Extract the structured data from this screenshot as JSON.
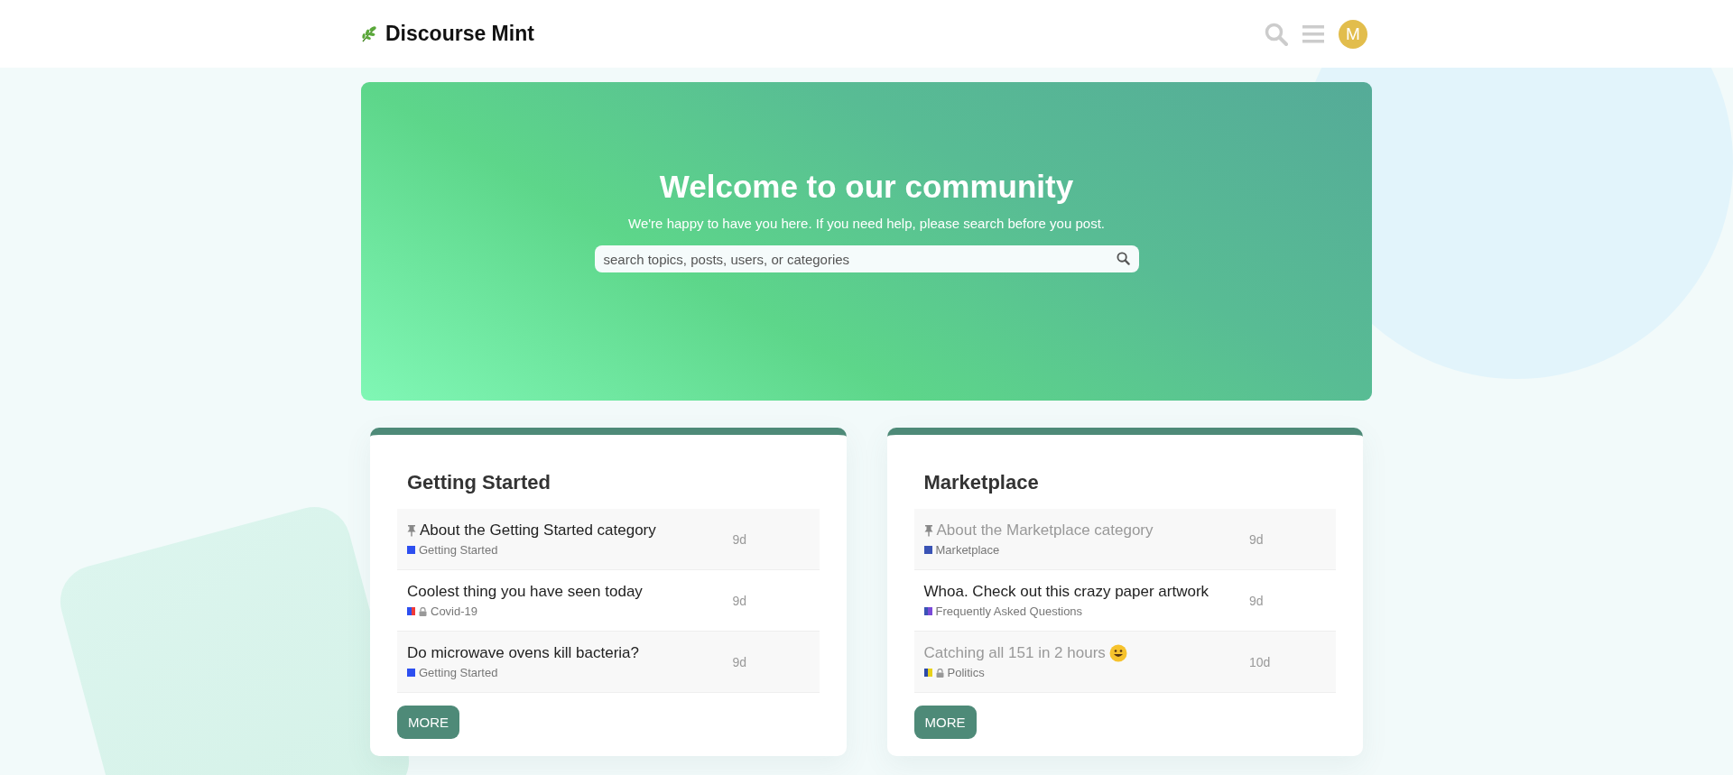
{
  "header": {
    "site_title": "Discourse Mint",
    "avatar_letter": "M"
  },
  "hero": {
    "title": "Welcome to our community",
    "subtitle": "We're happy to have you here. If you need help, please search before you post.",
    "search": {
      "placeholder": "search topics, posts, users, or categories"
    }
  },
  "categories": [
    {
      "name": "Getting Started",
      "more_button": "MORE",
      "topics": [
        {
          "title": "About the Getting Started category",
          "pinned": true,
          "read": false,
          "emoji": false,
          "category": {
            "name": "Getting Started",
            "locked": false,
            "stripes": [
              {
                "color": "#2d4ff0"
              }
            ]
          },
          "age": "9d"
        },
        {
          "title": "Coolest thing you have seen today",
          "pinned": false,
          "read": false,
          "emoji": false,
          "category": {
            "name": "Covid-19",
            "locked": true,
            "stripes": [
              {
                "color": "#2d4ff0"
              },
              {
                "color": "#f03a3a"
              }
            ]
          },
          "age": "9d"
        },
        {
          "title": "Do microwave ovens kill bacteria?",
          "pinned": false,
          "read": false,
          "emoji": false,
          "category": {
            "name": "Getting Started",
            "locked": false,
            "stripes": [
              {
                "color": "#2d4ff0"
              }
            ]
          },
          "age": "9d"
        }
      ]
    },
    {
      "name": "Marketplace",
      "more_button": "MORE",
      "topics": [
        {
          "title": "About the Marketplace category",
          "pinned": true,
          "read": true,
          "emoji": false,
          "category": {
            "name": "Marketplace",
            "locked": false,
            "stripes": [
              {
                "color": "#3a53b5"
              }
            ]
          },
          "age": "9d"
        },
        {
          "title": "Whoa. Check out this crazy paper artwork",
          "pinned": false,
          "read": false,
          "emoji": false,
          "category": {
            "name": "Frequently Asked Questions",
            "locked": false,
            "stripes": [
              {
                "color": "#3a53b5"
              },
              {
                "color": "#7a4ad8"
              }
            ]
          },
          "age": "9d"
        },
        {
          "title": "Catching all 151 in 2 hours",
          "pinned": false,
          "read": true,
          "emoji": true,
          "category": {
            "name": "Politics",
            "locked": true,
            "stripes": [
              {
                "color": "#2d4aa8"
              },
              {
                "color": "#e8d21a"
              }
            ]
          },
          "age": "10d"
        }
      ]
    }
  ]
}
